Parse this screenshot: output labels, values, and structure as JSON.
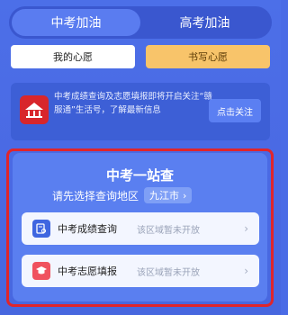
{
  "tabs": [
    {
      "label": "中考加油",
      "active": true
    },
    {
      "label": "高考加油",
      "active": false
    }
  ],
  "wish_buttons": {
    "mine": "我的心愿",
    "write": "书写心愿"
  },
  "notice": {
    "text": "中考成绩查询及志愿填报即将开启关注“赣服通”生活号，了解最新信息",
    "follow_button": "点击关注"
  },
  "query": {
    "title": "中考一站查",
    "region_prompt": "请先选择查询地区",
    "region_value": "九江市",
    "rows": [
      {
        "label": "中考成绩查询",
        "status": "该区域暂未开放",
        "icon": "score-query-icon"
      },
      {
        "label": "中考志愿填报",
        "status": "该区域暂未开放",
        "icon": "graduation-cap-icon"
      }
    ]
  },
  "colors": {
    "background": "#4a6be6",
    "highlight_border": "#e0252b",
    "accent_yellow": "#f8c46a"
  }
}
